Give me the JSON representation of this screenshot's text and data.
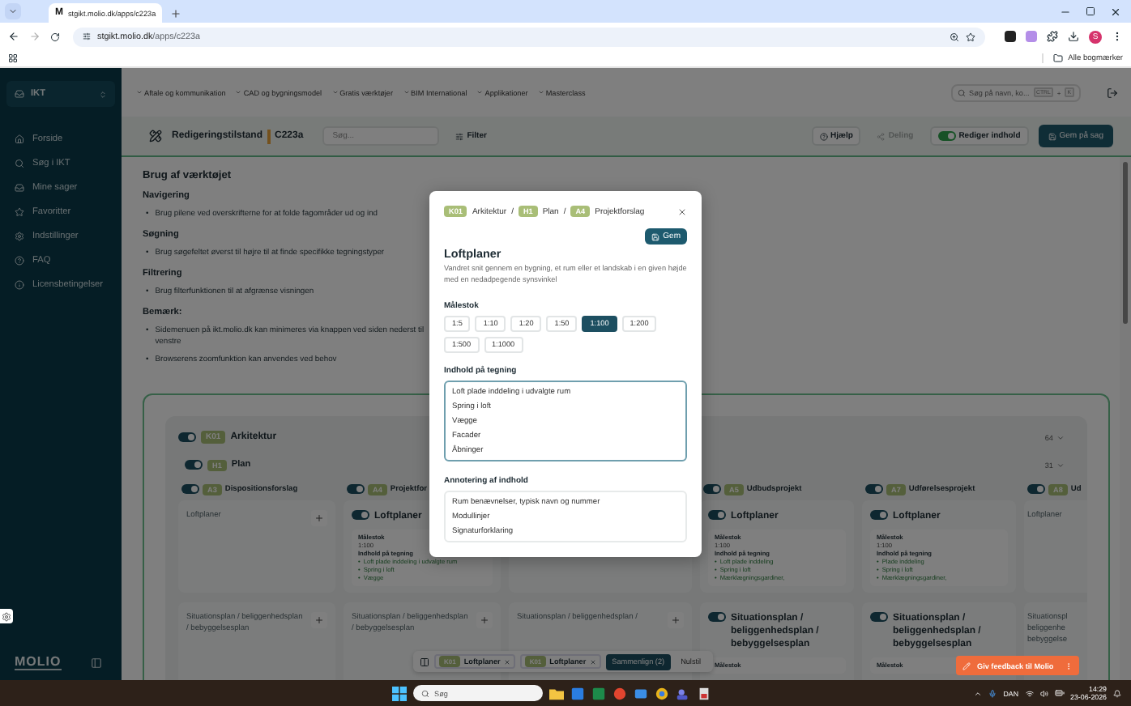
{
  "browser": {
    "favicon": "M",
    "tab_title": "stgikt.molio.dk/apps/c223a",
    "url_host": "stgikt.molio.dk",
    "url_path": "/apps/c223a",
    "avatar": "S",
    "bookmarks": "Alle bogmærker"
  },
  "sidebar": {
    "workspace": "IKT",
    "items": [
      {
        "label": "Forside"
      },
      {
        "label": "Søg i IKT"
      },
      {
        "label": "Mine sager"
      },
      {
        "label": "Favoritter"
      },
      {
        "label": "Indstillinger"
      },
      {
        "label": "FAQ"
      },
      {
        "label": "Licensbetingelser"
      }
    ],
    "logo": "MOLIO"
  },
  "top_nav": {
    "items": [
      "Aftale og kommunikation",
      "CAD og bygningsmodel",
      "Gratis værktøjer",
      "BIM International",
      "Applikationer",
      "Masterclass"
    ],
    "search_placeholder": "Søg på navn, ko...",
    "shortcut": [
      "CTRL",
      "+",
      "K"
    ]
  },
  "toolbar": {
    "mode": "Redigeringstilstand",
    "code": "C223a",
    "search_placeholder": "Søg...",
    "filter": "Filter",
    "help": "Hjælp",
    "share": {
      "label": "Deling",
      "disabled": true
    },
    "edit": {
      "label": "Rediger indhold",
      "on": true
    },
    "save": "Gem på sag"
  },
  "bullet": "•",
  "help": {
    "title": "Brug af værktøjet",
    "sections": [
      {
        "heading": "Navigering",
        "bullets": [
          "Brug pilene ved overskrifterne for at folde fagområder ud og ind"
        ]
      },
      {
        "heading": "Søgning",
        "bullets": [
          "Brug søgefeltet øverst til højre til at finde specifikke tegningstyper"
        ]
      },
      {
        "heading": "Filtrering",
        "bullets": [
          "Brug filterfunktionen til at afgrænse visningen"
        ]
      },
      {
        "heading": "Bemærk:",
        "bullets": [
          "Sidemenuen på ikt.molio.dk kan minimeres via knappen ved siden nederst til venstre",
          "Browserens zoomfunktion kan anvendes ved behov"
        ]
      }
    ]
  },
  "tree": {
    "discipline": {
      "code": "K01",
      "name": "Arkitektur",
      "on": true,
      "count": "64"
    },
    "group": {
      "code": "H1",
      "name": "Plan",
      "on": true,
      "count": "31"
    },
    "columns": [
      {
        "phase": {
          "code": "A3",
          "name": "Dispositionsforslag",
          "on": true
        },
        "cards": [
          {
            "kind": "empty",
            "title": "Loftplaner"
          },
          {
            "kind": "empty",
            "title": "Situationsplan / beliggenhedsplan / bebyggelsesplan"
          }
        ]
      },
      {
        "phase": {
          "code": "A4",
          "name": "Projektfor",
          "on": true
        },
        "cards": [
          {
            "kind": "filled",
            "title": "Loftplaner",
            "on": true,
            "scale_label": "Målestok",
            "scale": "1:100",
            "content_label": "Indhold på tegning",
            "content": [
              "Loft plade inddeling i udvalgte rum",
              "Spring i loft",
              "Vægge"
            ]
          },
          {
            "kind": "empty",
            "title": "Situationsplan / beliggenhedsplan / bebyggelsesplan"
          }
        ]
      },
      {
        "cards": [
          {
            "kind": "blank"
          },
          {
            "kind": "empty",
            "title": "Situationsplan / beliggenhedsplan /"
          }
        ]
      },
      {
        "phase": {
          "code": "A5",
          "name": "Udbudsprojekt",
          "on": true
        },
        "cards": [
          {
            "kind": "filled",
            "title": "Loftplaner",
            "on": true,
            "scale_label": "Målestok",
            "scale": "1:100",
            "content_label": "Indhold på tegning",
            "content": [
              "Loft plade inddeling",
              "Spring i loft",
              "Mærklægningsgardiner,"
            ]
          },
          {
            "kind": "filled",
            "title": "Situationsplan / beliggenhedsplan / bebyggelsesplan",
            "on": true,
            "scale_label": "Målestok"
          }
        ]
      },
      {
        "phase": {
          "code": "A7",
          "name": "Udførelsesprojekt",
          "on": true
        },
        "cards": [
          {
            "kind": "filled",
            "title": "Loftplaner",
            "on": true,
            "scale_label": "Målestok",
            "scale": "1:100",
            "content_label": "Indhold på tegning",
            "content": [
              "Plade inddeling",
              "Spring i loft",
              "Mærklægningsgardiner,"
            ]
          },
          {
            "kind": "filled",
            "title": "Situationsplan / beliggenhedsplan / bebyggelsesplan",
            "on": true,
            "scale_label": "Målestok"
          }
        ]
      },
      {
        "phase": {
          "code": "A8",
          "name": "Ud",
          "on": true
        },
        "cards": [
          {
            "kind": "cut",
            "title": "Loftplaner"
          },
          {
            "kind": "cut",
            "title": "Situationspl beliggenhe bebyggelse"
          }
        ]
      }
    ]
  },
  "compare_bar": {
    "chips": [
      {
        "code": "K01",
        "label": "Loftplaner"
      },
      {
        "code": "K01",
        "label": "Loftplaner"
      }
    ],
    "compare": "Sammenlign (2)",
    "reset": "Nulstil"
  },
  "feedback": "Giv feedback til Molio",
  "modal": {
    "breadcrumb": [
      {
        "code": "K01",
        "label": "Arkitektur"
      },
      {
        "code": "H1",
        "label": "Plan"
      },
      {
        "code": "A4",
        "label": "Projektforslag"
      }
    ],
    "separator": "/",
    "save": "Gem",
    "title": "Loftplaner",
    "description": "Vandret snit gennem en bygning, et rum eller et landskab i en given højde med en nedadpegende synsvinkel",
    "scale_label": "Målestok",
    "scales": [
      {
        "label": "1:5",
        "selected": false
      },
      {
        "label": "1:10",
        "selected": false
      },
      {
        "label": "1:20",
        "selected": false
      },
      {
        "label": "1:50",
        "selected": false
      },
      {
        "label": "1:100",
        "selected": true
      },
      {
        "label": "1:200",
        "selected": false
      },
      {
        "label": "1:500",
        "selected": false
      },
      {
        "label": "1:1000",
        "selected": false
      }
    ],
    "content": {
      "label": "Indhold på tegning",
      "focused": true,
      "lines": [
        "Loft plade inddeling i udvalgte rum",
        "Spring i loft",
        "Vægge",
        "Facader",
        "Åbninger"
      ]
    },
    "annotation": {
      "label": "Annotering af indhold",
      "focused": false,
      "lines": [
        "Rum benævnelser, typisk navn og nummer",
        "Modullinjer",
        "Signaturforklaring"
      ]
    }
  },
  "taskbar": {
    "search": "Søg",
    "language": "DAN",
    "time": "14:29",
    "date": "23-06-2026"
  }
}
